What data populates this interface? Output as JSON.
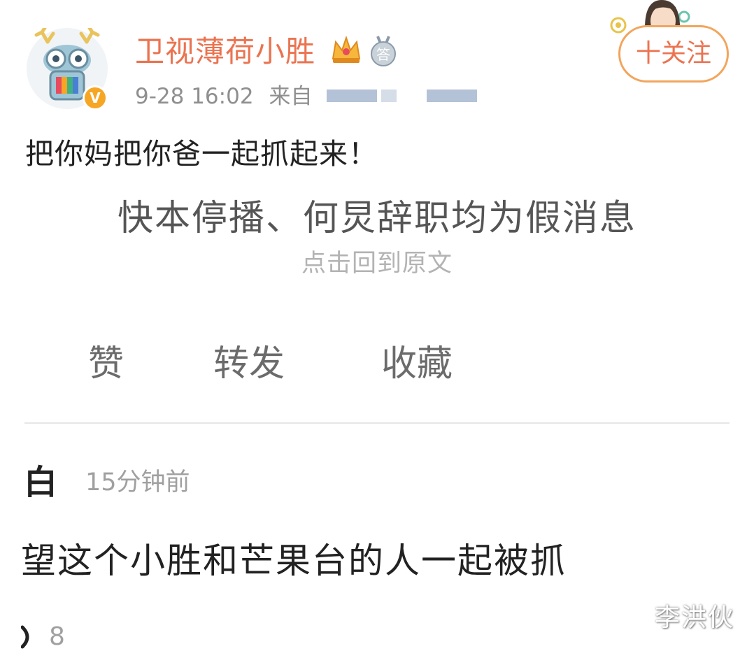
{
  "post": {
    "author": "卫视薄荷小胜",
    "timestamp": "9-28 16:02",
    "source_label": "来自",
    "follow_label": "十关注",
    "text": "把你妈把你爸一起抓起来！",
    "verified_mark": "V",
    "medal_char": "答"
  },
  "quoted": {
    "title": "快本停播、何炅辞职均为假消息",
    "link": "点击回到原文"
  },
  "actions": {
    "like": "赞",
    "repost": "转发",
    "favorite": "收藏"
  },
  "comment": {
    "name": "白",
    "time": "15分钟前",
    "text": "望这个小胜和芒果台的人一起被抓",
    "likes": "8"
  },
  "watermark": "李洪伙",
  "colors": {
    "accent": "#eb7350",
    "follow_border": "#f2a55d",
    "verified": "#f6a623",
    "meta_text": "#8f8f8f",
    "divider": "#e6e6e6"
  },
  "icons": [
    "avatar-icon",
    "verified-icon",
    "crown-icon",
    "medal-icon",
    "decor-girl-icon",
    "like-icon"
  ]
}
